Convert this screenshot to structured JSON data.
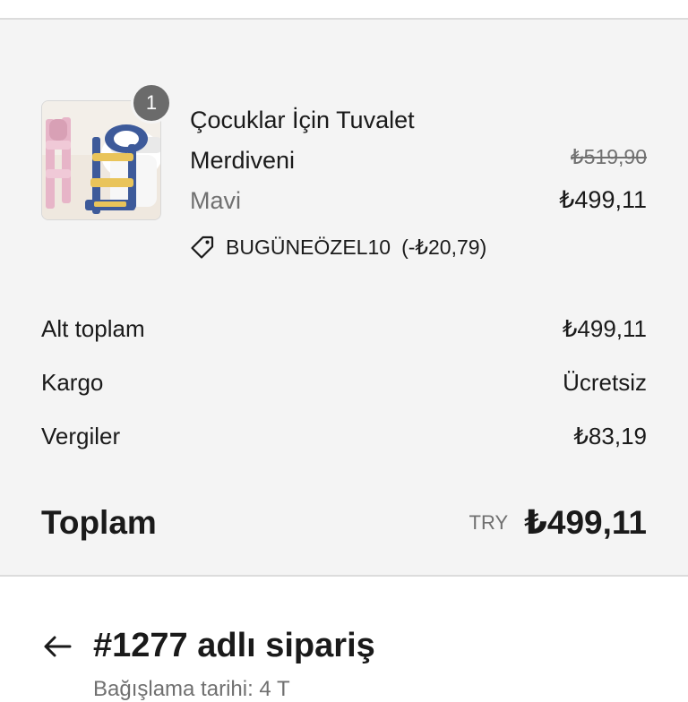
{
  "item": {
    "quantity": "1",
    "title_line1": "Çocuklar İçin Tuvalet",
    "title_line2": "Merdiveni",
    "variant": "Mavi",
    "original_price": "₺519,90",
    "price": "₺499,11",
    "discount_code": "BUGÜNEÖZEL10",
    "discount_amount": "(-₺20,79)",
    "image_icon": "toilet-ladder-product-image"
  },
  "summary": {
    "subtotal_label": "Alt toplam",
    "subtotal_value": "₺499,11",
    "shipping_label": "Kargo",
    "shipping_value": "Ücretsiz",
    "taxes_label": "Vergiler",
    "taxes_value": "₺83,19",
    "total_label": "Toplam",
    "total_currency": "TRY",
    "total_value": "₺499,11"
  },
  "order": {
    "title": "#1277 adlı sipariş",
    "subtitle": "Bağışlama tarihi: 4 T"
  },
  "colors": {
    "panel_bg": "#f4f4f4",
    "badge": "#6b6b6b",
    "muted_text": "#707070"
  }
}
